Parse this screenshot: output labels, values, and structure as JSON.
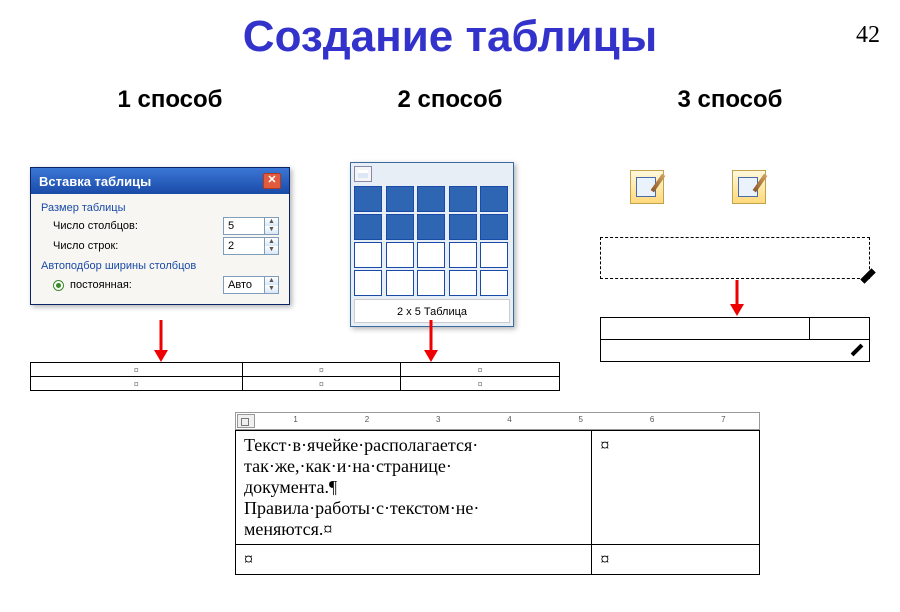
{
  "slide_number": "42",
  "title": "Создание таблицы",
  "method1_label": "1 способ",
  "method2_label": "2 способ",
  "method3_label": "3 способ",
  "dialog": {
    "title": "Вставка таблицы",
    "section_size": "Размер таблицы",
    "cols_label": "Число столбцов:",
    "cols_value": "5",
    "rows_label": "Число строк:",
    "rows_value": "2",
    "section_autofit": "Автоподбор ширины столбцов",
    "fixed_label": "постоянная:",
    "fixed_value": "Авто"
  },
  "grid_picker": {
    "footer": "2 x 5 Таблица"
  },
  "bottom_example": {
    "line1": "Текст·в·ячейке·располагается·",
    "line2": "так·же,·как·и·на·странице·",
    "line3": "документа.¶",
    "line4": "Правила·работы·с·текстом·не·",
    "line5": "меняются.¤",
    "cell_marker": "¤"
  },
  "ruler_marks": [
    "1",
    "2",
    "3",
    "4",
    "5",
    "6",
    "7"
  ]
}
